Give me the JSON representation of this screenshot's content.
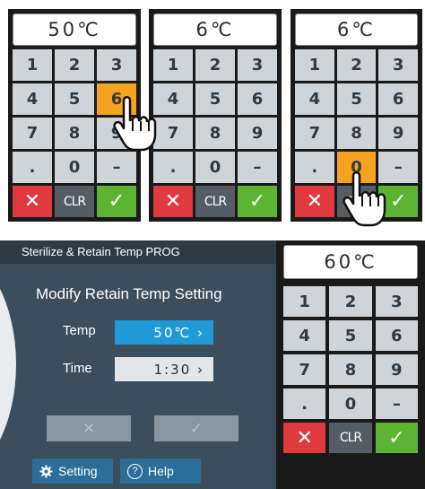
{
  "colors": {
    "key_bg": "#cfd4d8",
    "key_highlight": "#f6a21e",
    "cancel": "#e0393e",
    "clear": "#545c66",
    "confirm": "#5cb432",
    "screen_bg": "#3c4d5b",
    "temp_field": "#1f9ad6",
    "footer_button": "#2b6e99"
  },
  "keypads": [
    {
      "display": "50℃",
      "keys": [
        "1",
        "2",
        "3",
        "4",
        "5",
        "6",
        "7",
        "8",
        "9",
        ".",
        "0",
        "–"
      ],
      "pressed_key": "6",
      "action_keys": {
        "cancel": "✕",
        "clear": "CLR",
        "confirm": "✓"
      }
    },
    {
      "display": "6℃",
      "keys": [
        "1",
        "2",
        "3",
        "4",
        "5",
        "6",
        "7",
        "8",
        "9",
        ".",
        "0",
        "–"
      ],
      "pressed_key": "",
      "action_keys": {
        "cancel": "✕",
        "clear": "CLR",
        "confirm": "✓"
      }
    },
    {
      "display": "6℃",
      "keys": [
        "1",
        "2",
        "3",
        "4",
        "5",
        "6",
        "7",
        "8",
        "9",
        ".",
        "0",
        "–"
      ],
      "pressed_key": "0",
      "action_keys": {
        "cancel": "✕",
        "clear": "CLR",
        "confirm": "✓"
      }
    },
    {
      "display": "60℃",
      "keys": [
        "1",
        "2",
        "3",
        "4",
        "5",
        "6",
        "7",
        "8",
        "9",
        ".",
        "0",
        "–"
      ],
      "pressed_key": "",
      "action_keys": {
        "cancel": "✕",
        "clear": "CLR",
        "confirm": "✓"
      }
    }
  ],
  "settings": {
    "title": "Sterilize & Retain Temp PROG",
    "heading": "Modify Retain Temp Setting",
    "temp_label": "Temp",
    "temp_value": "50℃ ›",
    "time_label": "Time",
    "time_value": "1:30 ›",
    "cancel_symbol": "✕",
    "confirm_symbol": "✓",
    "setting_label": "Setting",
    "help_label": "Help",
    "help_icon_glyph": "?"
  },
  "icons": [
    "gear-icon",
    "help-icon",
    "hand-pointer-icon"
  ]
}
